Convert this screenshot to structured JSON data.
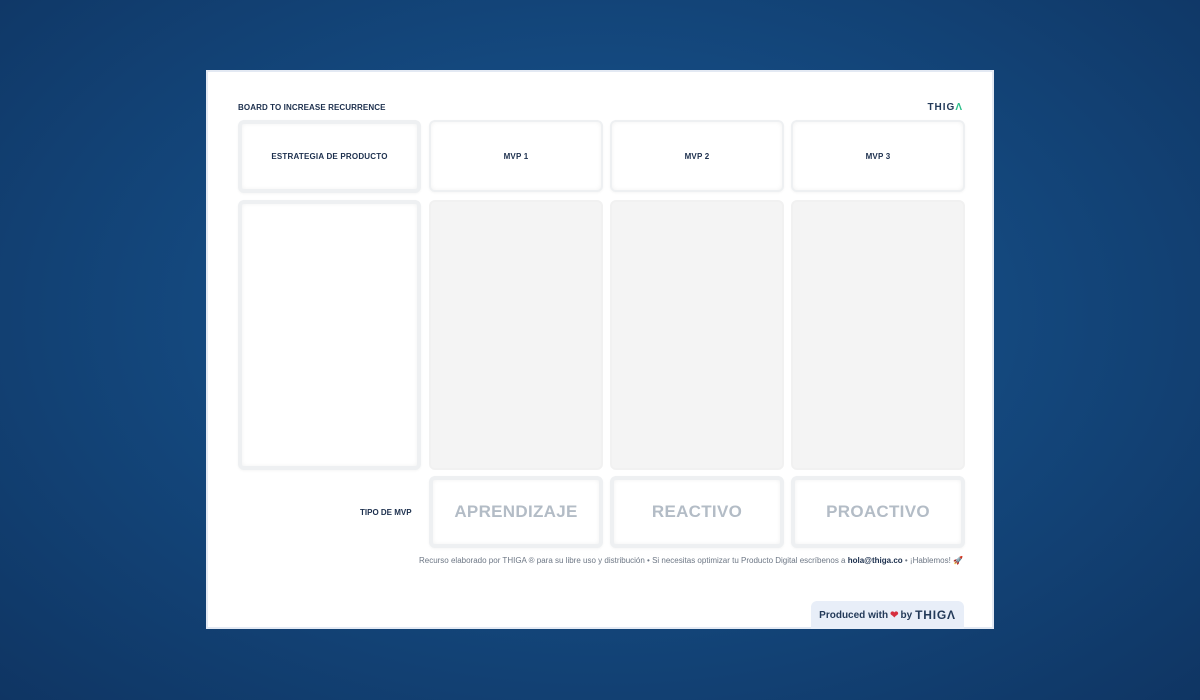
{
  "board": {
    "title": "BOARD TO INCREASE RECURRENCE",
    "logo": {
      "text": "THIG",
      "accent_text": "Λ",
      "accent_color": "#2dbf8a"
    },
    "headers": {
      "strategy": "ESTRATEGIA DE PRODUCTO",
      "mvp1": "MVP 1",
      "mvp2": "MVP 2",
      "mvp3": "MVP 3"
    },
    "tipo_label": "TIPO DE MVP",
    "types": [
      "APRENDIZAJE",
      "REACTIVO",
      "PROACTIVO"
    ]
  },
  "footer": {
    "text_before": "Recurso elaborado por THIGA ® para su libre uso y distribución  •  Si necesitas optimizar tu Producto Digital escríbenos a ",
    "email": "hola@thiga.co",
    "text_after": "  •  ¡Hablemos! 🚀"
  },
  "badge": {
    "prefix": "Produced with",
    "heart": "❤",
    "by": "by",
    "logo_text": "THIG",
    "logo_accent": "Λ"
  },
  "colors": {
    "background": "#14497f",
    "board": "#ffffff",
    "text_dark": "#1c2f4d",
    "type_text": "#b3bcc6",
    "heart": "#d62f3e"
  }
}
